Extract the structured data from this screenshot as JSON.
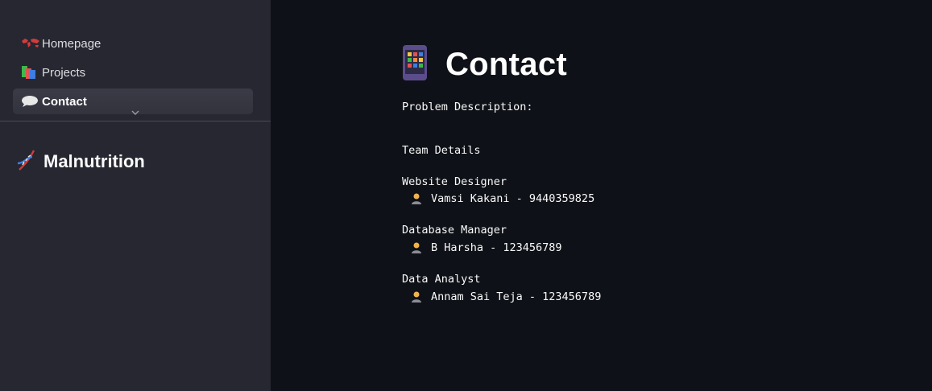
{
  "sidebar": {
    "nav": [
      {
        "label": "Homepage",
        "icon": "world-map-icon"
      },
      {
        "label": "Projects",
        "icon": "books-icon"
      },
      {
        "label": "Contact",
        "icon": "speech-bubble-icon",
        "active": true
      }
    ],
    "brand": {
      "label": "Malnutrition",
      "icon": "dna-icon"
    }
  },
  "main": {
    "title": "Contact",
    "title_icon": "mobile-phone-icon",
    "problem_label": "Problem Description:",
    "team_label": "Team Details",
    "roles": [
      {
        "role": "Website Designer",
        "member": "Vamsi Kakani - 9440359825"
      },
      {
        "role": "Database Manager",
        "member": "B Harsha - 123456789"
      },
      {
        "role": "Data Analyst",
        "member": "Annam Sai Teja - 123456789"
      }
    ]
  }
}
